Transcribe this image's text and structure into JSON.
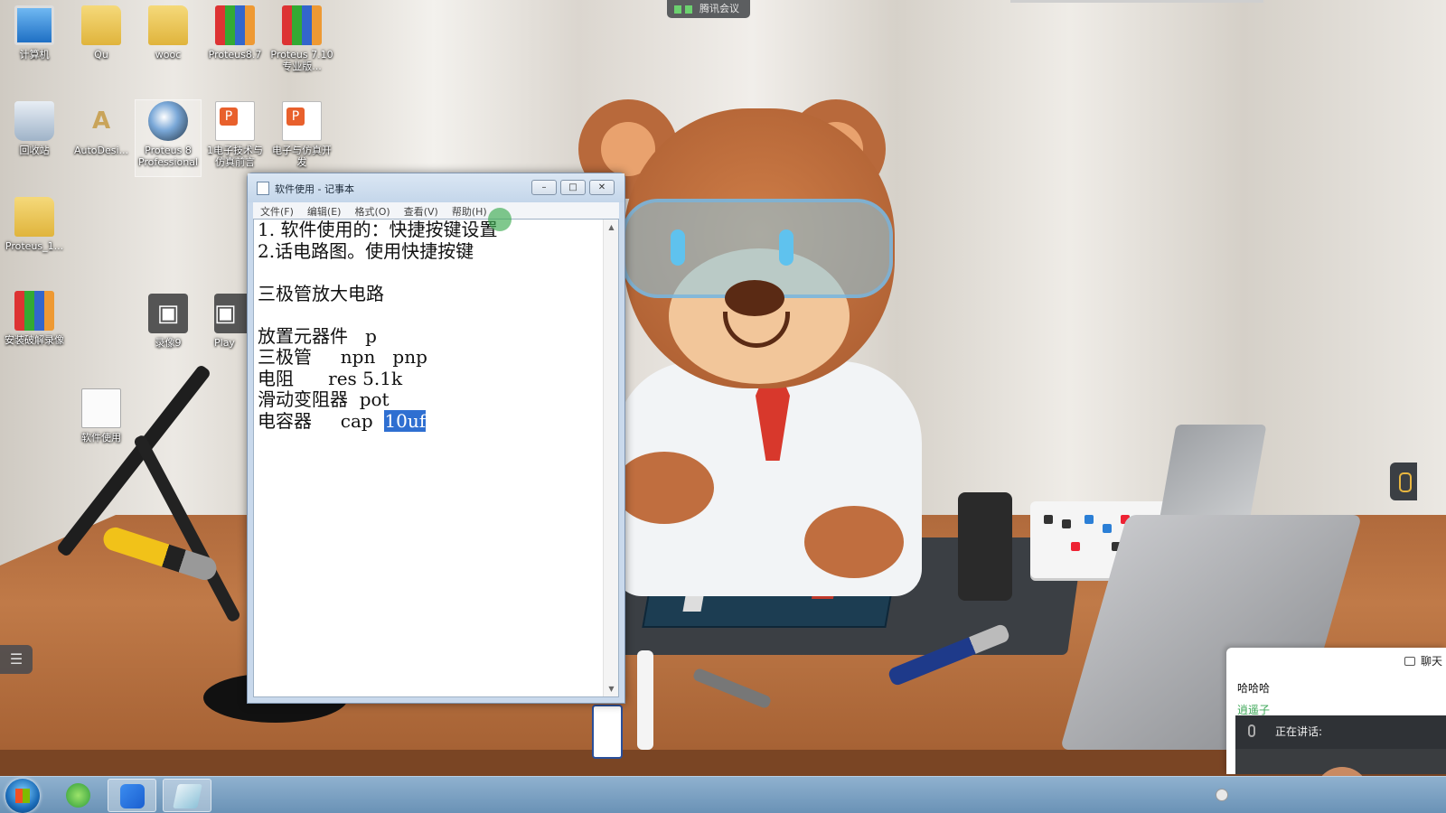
{
  "meeting": {
    "indicator_label": "腾讯会议"
  },
  "desktop": {
    "icons": [
      {
        "label": "计算机",
        "icon": "computer-icon"
      },
      {
        "label": "Qu",
        "icon": "folder-icon"
      },
      {
        "label": "wooc",
        "icon": "folder-icon"
      },
      {
        "label": "Proteus8.7",
        "icon": "winrar-icon"
      },
      {
        "label": "Proteus 7.10专业版...",
        "icon": "winrar-icon"
      },
      {
        "label": "回收站",
        "icon": "recycle-bin-icon"
      },
      {
        "label": "AutoDesi...",
        "icon": "autodesk-icon"
      },
      {
        "label": "Proteus 8 Professional",
        "icon": "proteus-globe-icon"
      },
      {
        "label": "1电子技术与仿真前言",
        "icon": "powerpoint-icon"
      },
      {
        "label": "电子与仿真开发",
        "icon": "powerpoint-icon"
      },
      {
        "label": "Proteus_1...",
        "icon": "folder-icon"
      },
      {
        "label": "安装破解录像",
        "icon": "winrar-icon"
      },
      {
        "label": "录像9",
        "icon": "recorder-icon"
      },
      {
        "label": "Play",
        "icon": "recorder-icon"
      },
      {
        "label": "软件使用",
        "icon": "text-document-icon"
      }
    ]
  },
  "notepad": {
    "title": "软件使用 - 记事本",
    "controls": {
      "minimize": "–",
      "maximize": "□",
      "close": "✕"
    },
    "menu": [
      "文件(F)",
      "编辑(E)",
      "格式(O)",
      "查看(V)",
      "帮助(H)"
    ],
    "lines": [
      "1. 软件使用的：快捷按键设置",
      "2.话电路图。使用快捷按键",
      "",
      "三极管放大电路",
      "",
      "放置元器件   p",
      "三极管     npn   pnp",
      "电阻      res 5.1k",
      "滑动变阻器  pot",
      "电容器     cap  "
    ],
    "selected_text": "10uf",
    "scroll": {
      "up": "▲",
      "down": "▼"
    }
  },
  "side_panel": {
    "list_button": "☰"
  },
  "chat": {
    "tab_label": "聊天",
    "message": "哈哈哈",
    "sender": "逍遥子",
    "speaking_label": "正在讲话:"
  },
  "taskbar": {
    "items": [
      "start-button",
      "360-browser",
      "tencent-meeting",
      "notepad"
    ]
  },
  "colors": {
    "selection": "#2f6fd1",
    "chat_sender": "#3aa655",
    "meeting_signal": "#5fcf63"
  }
}
